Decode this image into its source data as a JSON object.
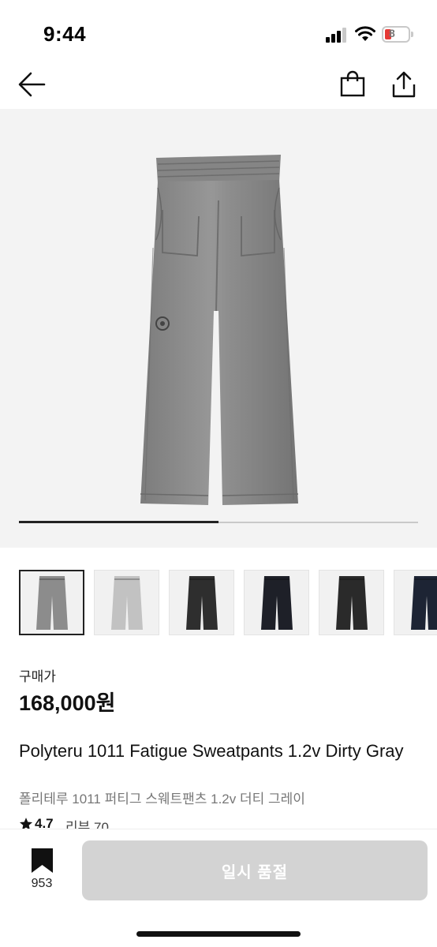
{
  "status_bar": {
    "time": "9:44",
    "battery": "8"
  },
  "nav": {
    "back_icon": "arrow-left",
    "cart_icon": "shopping-bag",
    "share_icon": "share-upload"
  },
  "gallery": {
    "current_index": 1,
    "total": 2,
    "progress_fraction": 0.5,
    "product_color": "#8a8a8a"
  },
  "thumbnails": [
    {
      "color": "#8c8c8c",
      "selected": true
    },
    {
      "color": "#c2c2c2",
      "selected": false
    },
    {
      "color": "#2e2e2e",
      "selected": false
    },
    {
      "color": "#1e2028",
      "selected": false
    },
    {
      "color": "#2a2a2a",
      "selected": false
    },
    {
      "color": "#1d2434",
      "selected": false
    }
  ],
  "price": {
    "label": "구매가",
    "value": "168,000원"
  },
  "product": {
    "name_en": "Polyteru 1011 Fatigue Sweatpants 1.2v Dirty Gray",
    "name_ko": "폴리테루 1011 퍼티그 스웨트팬츠 1.2v 더티 그레이"
  },
  "rating": {
    "score": "4.7",
    "review_label": "리뷰 70"
  },
  "bottom": {
    "bookmark_count": "953",
    "button_label": "일시 품절",
    "button_color": "#d3d3d3"
  }
}
